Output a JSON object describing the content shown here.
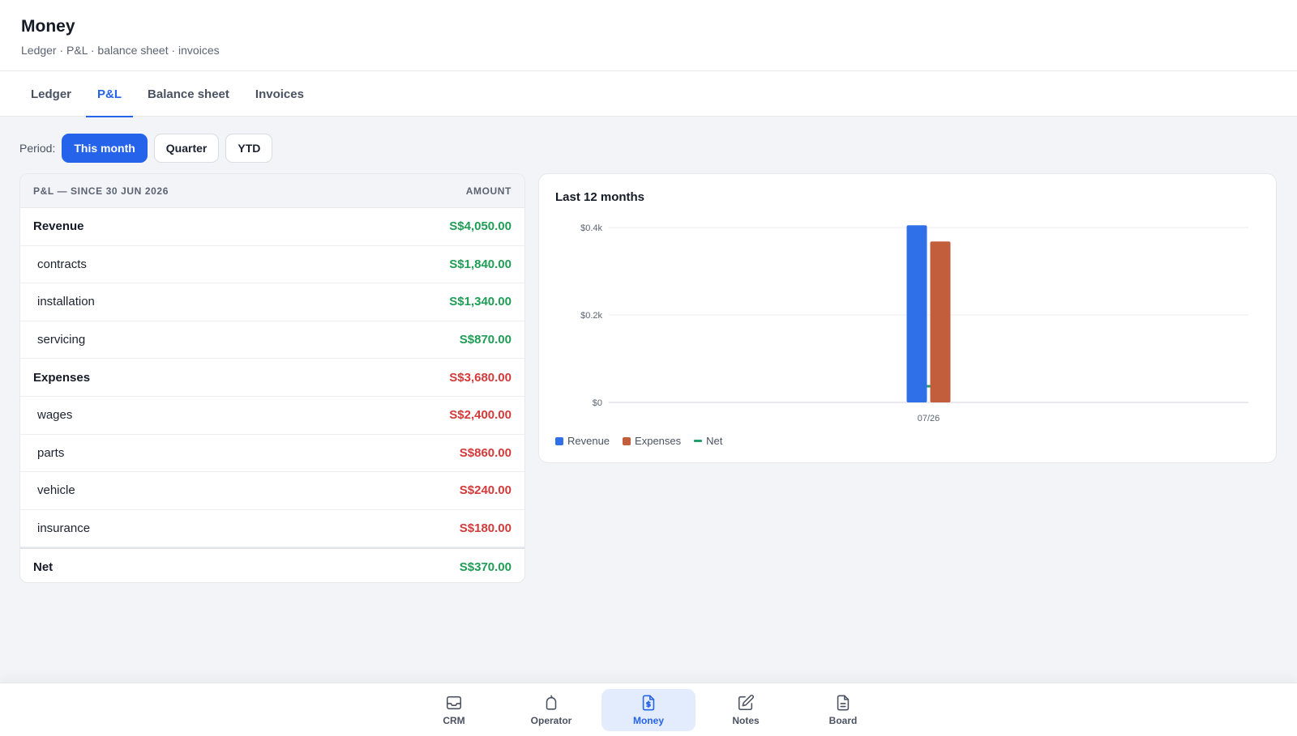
{
  "header": {
    "title": "Money",
    "subtitle": "Ledger · P&L · balance sheet · invoices"
  },
  "tabs": [
    {
      "label": "Ledger",
      "active": false
    },
    {
      "label": "P&L",
      "active": true
    },
    {
      "label": "Balance sheet",
      "active": false
    },
    {
      "label": "Invoices",
      "active": false
    }
  ],
  "period": {
    "label": "Period:",
    "options": [
      {
        "label": "This month",
        "active": true
      },
      {
        "label": "Quarter",
        "active": false
      },
      {
        "label": "YTD",
        "active": false
      }
    ]
  },
  "pl": {
    "header_left": "P&L — SINCE 30 JUN 2026",
    "header_right": "AMOUNT",
    "rows": [
      {
        "label": "Revenue",
        "amount": "S$4,050.00",
        "kind": "section",
        "tone": "pos"
      },
      {
        "label": "contracts",
        "amount": "S$1,840.00",
        "kind": "item",
        "tone": "pos"
      },
      {
        "label": "installation",
        "amount": "S$1,340.00",
        "kind": "item",
        "tone": "pos"
      },
      {
        "label": "servicing",
        "amount": "S$870.00",
        "kind": "item",
        "tone": "pos"
      },
      {
        "label": "Expenses",
        "amount": "S$3,680.00",
        "kind": "section",
        "tone": "neg"
      },
      {
        "label": "wages",
        "amount": "S$2,400.00",
        "kind": "item",
        "tone": "neg"
      },
      {
        "label": "parts",
        "amount": "S$860.00",
        "kind": "item",
        "tone": "neg"
      },
      {
        "label": "vehicle",
        "amount": "S$240.00",
        "kind": "item",
        "tone": "neg"
      },
      {
        "label": "insurance",
        "amount": "S$180.00",
        "kind": "item",
        "tone": "neg"
      }
    ],
    "net": {
      "label": "Net",
      "amount": "S$370.00",
      "tone": "pos"
    }
  },
  "chart_data": {
    "type": "bar",
    "title": "Last 12 months",
    "categories": [
      "07/26"
    ],
    "series": [
      {
        "name": "Revenue",
        "values": [
          405
        ],
        "color": "#2f6fe8"
      },
      {
        "name": "Expenses",
        "values": [
          368
        ],
        "color": "#c25e3c"
      },
      {
        "name": "Net",
        "values": [
          37
        ],
        "color": "#22a06b",
        "style": "line"
      }
    ],
    "y_ticks": [
      "$0",
      "$0.2k",
      "$0.4k"
    ],
    "y_tick_values": [
      0,
      200,
      400
    ],
    "ylim": [
      0,
      400
    ],
    "grid": true,
    "legend_position": "bottom-left"
  },
  "bottom_nav": {
    "items": [
      {
        "label": "CRM",
        "icon": "inbox-icon",
        "active": false
      },
      {
        "label": "Operator",
        "icon": "operator-icon",
        "active": false
      },
      {
        "label": "Money",
        "icon": "invoice-icon",
        "active": true
      },
      {
        "label": "Notes",
        "icon": "edit-icon",
        "active": false
      },
      {
        "label": "Board",
        "icon": "document-icon",
        "active": false
      }
    ]
  },
  "colors": {
    "accent": "#2563eb",
    "positive": "#1f9d55",
    "negative": "#d33a3a"
  }
}
